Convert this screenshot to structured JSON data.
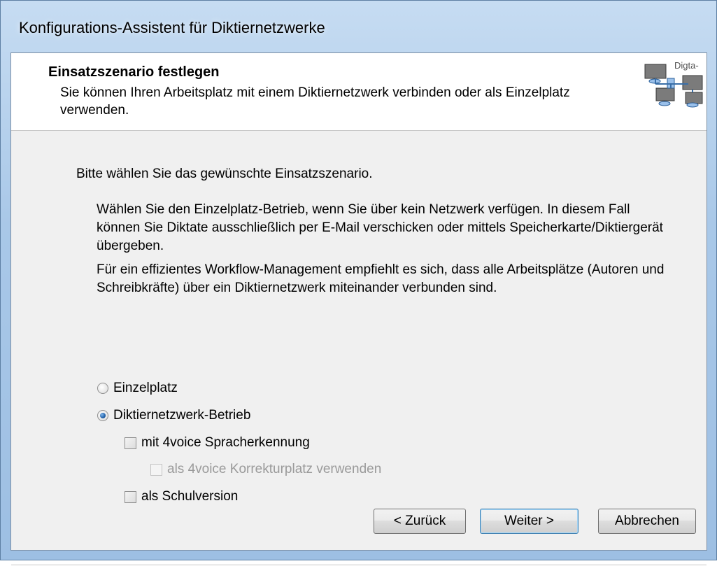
{
  "window": {
    "title": "Konfigurations-Assistent für Diktiernetzwerke"
  },
  "header": {
    "title": "Einsatzszenario festlegen",
    "description": "Sie können Ihren Arbeitsplatz mit einem Diktiernetzwerk verbinden oder als Einzelplatz verwenden.",
    "logo_text": "Digta-",
    "logo_icon": "network-computers-icon"
  },
  "content": {
    "intro": "Bitte wählen Sie das gewünschte Einsatzszenario.",
    "paragraph1": "Wählen Sie den Einzelplatz-Betrieb, wenn Sie über kein Netzwerk verfügen. In diesem Fall können Sie Diktate ausschließlich per E-Mail verschicken oder mittels Speicherkarte/Diktiergerät übergeben.",
    "paragraph2": "Für ein effizientes Workflow-Management empfiehlt es sich, dass alle Arbeitsplätze (Autoren und Schreibkräfte) über ein Diktiernetzwerk miteinander verbunden sind."
  },
  "options": {
    "einzelplatz": {
      "label": "Einzelplatz",
      "selected": false
    },
    "netzwerk": {
      "label": "Diktiernetzwerk-Betrieb",
      "selected": true
    },
    "voice": {
      "label": "mit 4voice Spracherkennung",
      "checked": false
    },
    "korrektur": {
      "label": "als 4voice Korrekturplatz verwenden",
      "checked": false,
      "disabled": true
    },
    "schulversion": {
      "label": "als Schulversion",
      "checked": false
    }
  },
  "buttons": {
    "back": "< Zurück",
    "next": "Weiter >",
    "cancel": "Abbrechen"
  }
}
